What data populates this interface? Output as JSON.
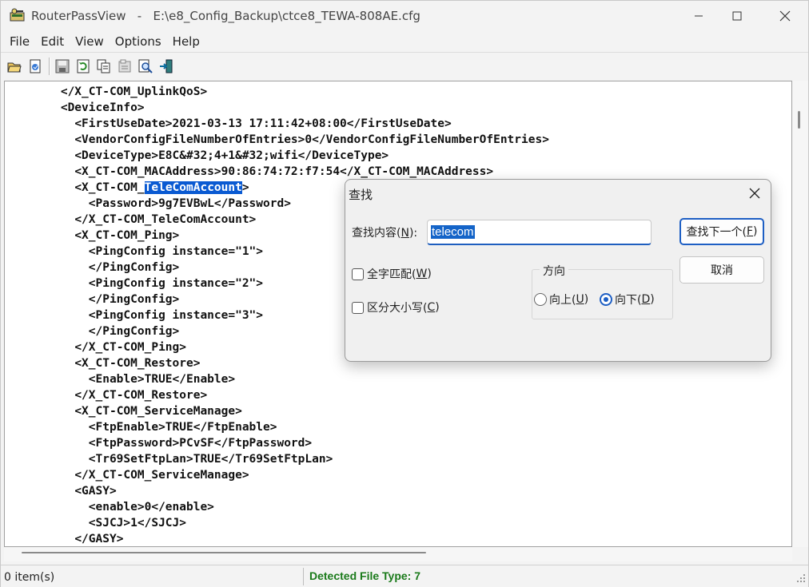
{
  "window": {
    "title": "RouterPassView   -   E:\\e8_Config_Backup\\ctce8_TEWA-808AE.cfg"
  },
  "menu": [
    "File",
    "Edit",
    "View",
    "Options",
    "Help"
  ],
  "toolbar": {
    "icons": [
      "open-folder-icon",
      "open-file-icon",
      "save-icon",
      "refresh-icon",
      "copy-icon",
      "properties-icon",
      "find-icon",
      "exit-icon"
    ]
  },
  "code": {
    "lines": [
      {
        "indent": "  ",
        "text": "</X_CT-COM_UplinkQoS>"
      },
      {
        "indent": "  ",
        "text": "<DeviceInfo>"
      },
      {
        "indent": "    ",
        "text": "<FirstUseDate>2021-03-13 17:11:42+08:00</FirstUseDate>"
      },
      {
        "indent": "    ",
        "text": "<VendorConfigFileNumberOfEntries>0</VendorConfigFileNumberOfEntries>"
      },
      {
        "indent": "    ",
        "text": "<DeviceType>E8C&#32;4+1&#32;wifi</DeviceType>"
      },
      {
        "indent": "    ",
        "text": "<X_CT-COM_MACAddress>90:86:74:72:f7:54</X_CT-COM_MACAddress>"
      },
      {
        "indent": "    ",
        "pre": "<X_CT-COM_",
        "hl": "TeleComAccount",
        "post": ">"
      },
      {
        "indent": "      ",
        "text": "<Password>9g7EVBwL</Password>"
      },
      {
        "indent": "    ",
        "text": "</X_CT-COM_TeleComAccount>"
      },
      {
        "indent": "    ",
        "text": "<X_CT-COM_Ping>"
      },
      {
        "indent": "      ",
        "text": "<PingConfig instance=\"1\">"
      },
      {
        "indent": "      ",
        "text": "</PingConfig>"
      },
      {
        "indent": "      ",
        "text": "<PingConfig instance=\"2\">"
      },
      {
        "indent": "      ",
        "text": "</PingConfig>"
      },
      {
        "indent": "      ",
        "text": "<PingConfig instance=\"3\">"
      },
      {
        "indent": "      ",
        "text": "</PingConfig>"
      },
      {
        "indent": "    ",
        "text": "</X_CT-COM_Ping>"
      },
      {
        "indent": "    ",
        "text": "<X_CT-COM_Restore>"
      },
      {
        "indent": "      ",
        "text": "<Enable>TRUE</Enable>"
      },
      {
        "indent": "    ",
        "text": "</X_CT-COM_Restore>"
      },
      {
        "indent": "    ",
        "text": "<X_CT-COM_ServiceManage>"
      },
      {
        "indent": "      ",
        "text": "<FtpEnable>TRUE</FtpEnable>"
      },
      {
        "indent": "      ",
        "text": "<FtpPassword>PCvSF</FtpPassword>"
      },
      {
        "indent": "      ",
        "text": "<Tr69SetFtpLan>TRUE</Tr69SetFtpLan>"
      },
      {
        "indent": "    ",
        "text": "</X_CT-COM_ServiceManage>"
      },
      {
        "indent": "    ",
        "text": "<GASY>"
      },
      {
        "indent": "      ",
        "text": "<enable>0</enable>"
      },
      {
        "indent": "      ",
        "text": "<SJCJ>1</SJCJ>"
      },
      {
        "indent": "    ",
        "text": "</GASY>"
      }
    ]
  },
  "status": {
    "items": "0 item(s)",
    "detected": "Detected File Type: 7"
  },
  "find_dialog": {
    "title": "查找",
    "find_label": "查找内容(N):",
    "find_label_pre": "查找内容(",
    "find_label_key": "N",
    "find_label_post": "):",
    "find_value": "telecom",
    "next_pre": "查找下一个(",
    "next_key": "F",
    "next_post": ")",
    "cancel": "取消",
    "whole_pre": "全字匹配(",
    "whole_key": "W",
    "whole_post": ")",
    "case_pre": "区分大小写(",
    "case_key": "C",
    "case_post": ")",
    "direction": "方向",
    "up_pre": "向上(",
    "up_key": "U",
    "up_post": ")",
    "down_pre": "向下(",
    "down_key": "D",
    "down_post": ")",
    "direction_selected": "down"
  },
  "colors": {
    "highlight": "#0a5ad2",
    "accent": "#1e5fc4",
    "status_green": "#1a7a1a"
  }
}
